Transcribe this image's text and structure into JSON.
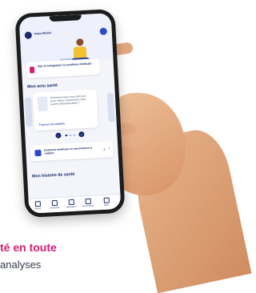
{
  "app": {
    "user_name": "Inaya Michel",
    "synth_card": "Voir et enregistrer la synthèse médicale",
    "actu_title": "Mon actu santé",
    "actu_card_text": "Comment avez-vous été suivi pour mieux comprendre votre santé cardiovasculaire ?",
    "actu_link": "Trouvez vos actions",
    "dossier_card": "Examens médicaux et vaccinations à réaliser",
    "dossier_count": "1",
    "history_title": "Mon histoire de santé",
    "bottom_nav": [
      {
        "label": "Accueil"
      },
      {
        "label": "Documents"
      },
      {
        "label": "Messagerie"
      },
      {
        "label": "Profil médical"
      },
      {
        "label": "Menu"
      }
    ]
  },
  "captions": {
    "line1": "té en toute",
    "line2": "analyses"
  },
  "colors": {
    "accent": "#d61c73",
    "navy": "#1b2a6b",
    "blue": "#2f47c7"
  }
}
